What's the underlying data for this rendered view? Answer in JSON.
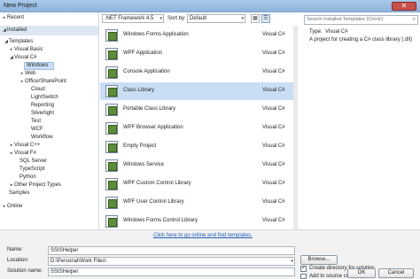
{
  "window": {
    "title": "New Project",
    "close_glyph": "✕"
  },
  "tree": [
    {
      "label": "Recent",
      "expander": "▸",
      "depth": 0
    },
    {
      "label": "Installed",
      "expander": "◢",
      "depth": 0
    },
    {
      "label": "Templates",
      "expander": "◢",
      "depth": 0
    },
    {
      "label": "Visual Basic",
      "expander": "▸",
      "depth": 1
    },
    {
      "label": "Visual C#",
      "expander": "◢",
      "depth": 1
    },
    {
      "label": "Windows",
      "expander": "",
      "depth": 2
    },
    {
      "label": "Web",
      "expander": "▸",
      "depth": 2
    },
    {
      "label": "Office/SharePoint",
      "expander": "▸",
      "depth": 2
    },
    {
      "label": "Cloud",
      "expander": "",
      "depth": 2
    },
    {
      "label": "LightSwitch",
      "expander": "",
      "depth": 2
    },
    {
      "label": "Reporting",
      "expander": "",
      "depth": 2
    },
    {
      "label": "Silverlight",
      "expander": "",
      "depth": 2
    },
    {
      "label": "Test",
      "expander": "",
      "depth": 2
    },
    {
      "label": "WCF",
      "expander": "",
      "depth": 2
    },
    {
      "label": "Workflow",
      "expander": "",
      "depth": 2
    },
    {
      "label": "Visual C++",
      "expander": "▸",
      "depth": 1
    },
    {
      "label": "Visual F#",
      "expander": "▸",
      "depth": 1
    },
    {
      "label": "SQL Server",
      "expander": "",
      "depth": 1
    },
    {
      "label": "TypeScript",
      "expander": "",
      "depth": 1
    },
    {
      "label": "Python",
      "expander": "",
      "depth": 1
    },
    {
      "label": "Other Project Types",
      "expander": "▸",
      "depth": 1
    },
    {
      "label": "Samples",
      "expander": "",
      "depth": 1
    },
    {
      "label": "Online",
      "expander": "▸",
      "depth": 0
    }
  ],
  "toolbar": {
    "framework": ".NET Framework 4.5",
    "sort_label": "Sort by:",
    "sort_value": "Default",
    "arrow": "▾",
    "small_icons_glyph": "▦",
    "list_view_glyph": "☰"
  },
  "templates": [
    {
      "name": "Windows Forms Application",
      "lang": "Visual C#"
    },
    {
      "name": "WPF Application",
      "lang": "Visual C#"
    },
    {
      "name": "Console Application",
      "lang": "Visual C#"
    },
    {
      "name": "Class Library",
      "lang": "Visual C#"
    },
    {
      "name": "Portable Class Library",
      "lang": "Visual C#"
    },
    {
      "name": "WPF Browser Application",
      "lang": "Visual C#"
    },
    {
      "name": "Empty Project",
      "lang": "Visual C#"
    },
    {
      "name": "Windows Service",
      "lang": "Visual C#"
    },
    {
      "name": "WPF Custom Control Library",
      "lang": "Visual C#"
    },
    {
      "name": "WPF User Control Library",
      "lang": "Visual C#"
    },
    {
      "name": "Windows Forms Control Library",
      "lang": "Visual C#"
    }
  ],
  "search": {
    "placeholder": "Search Installed Templates (Ctrl+E)",
    "icon": "⌕"
  },
  "details": {
    "type_label": "Type:",
    "type_value": "Visual C#",
    "description": "A project for creating a C# class library (.dll)"
  },
  "online_link": "Click here to go online and find templates.",
  "form": {
    "name_label": "Name:",
    "name_value": "SSISHelper",
    "location_label": "Location:",
    "location_value": "D:\\Personal\\Work Files\\",
    "solution_label": "Solution name:",
    "solution_value": "SSISHelper",
    "browse_label": "Browse...",
    "create_dir_label": "Create directory for solution",
    "create_dir_checked": true,
    "add_sc_label": "Add to source control",
    "add_sc_checked": false,
    "check_glyph": "✓",
    "ok_label": "OK",
    "cancel_label": "Cancel"
  }
}
